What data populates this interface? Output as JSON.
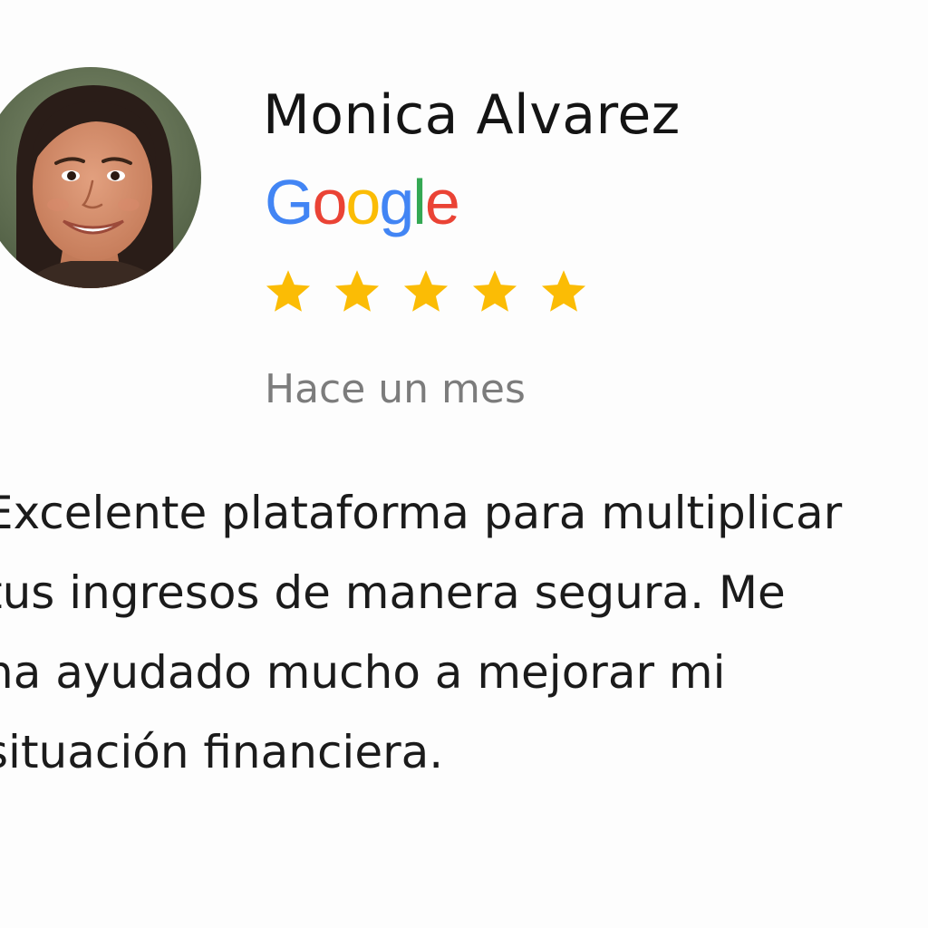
{
  "reviewer": {
    "name": "Monica Alvarez",
    "avatar_icon": "profile-photo"
  },
  "source": {
    "logo_letters": [
      {
        "char": "G",
        "color": "#4285F4"
      },
      {
        "char": "o",
        "color": "#EA4335"
      },
      {
        "char": "o",
        "color": "#FBBC05"
      },
      {
        "char": "g",
        "color": "#4285F4"
      },
      {
        "char": "l",
        "color": "#34A853"
      },
      {
        "char": "e",
        "color": "#EA4335"
      }
    ]
  },
  "rating": {
    "stars": 5,
    "max": 5,
    "star_color": "#FBBC05"
  },
  "review": {
    "date": "Hace un mes",
    "text_lines": [
      "Excelente plataforma para multiplicar",
      "tus ingresos de manera segura. Me",
      "ha ayudado mucho a mejorar mi",
      "situación financiera."
    ]
  }
}
